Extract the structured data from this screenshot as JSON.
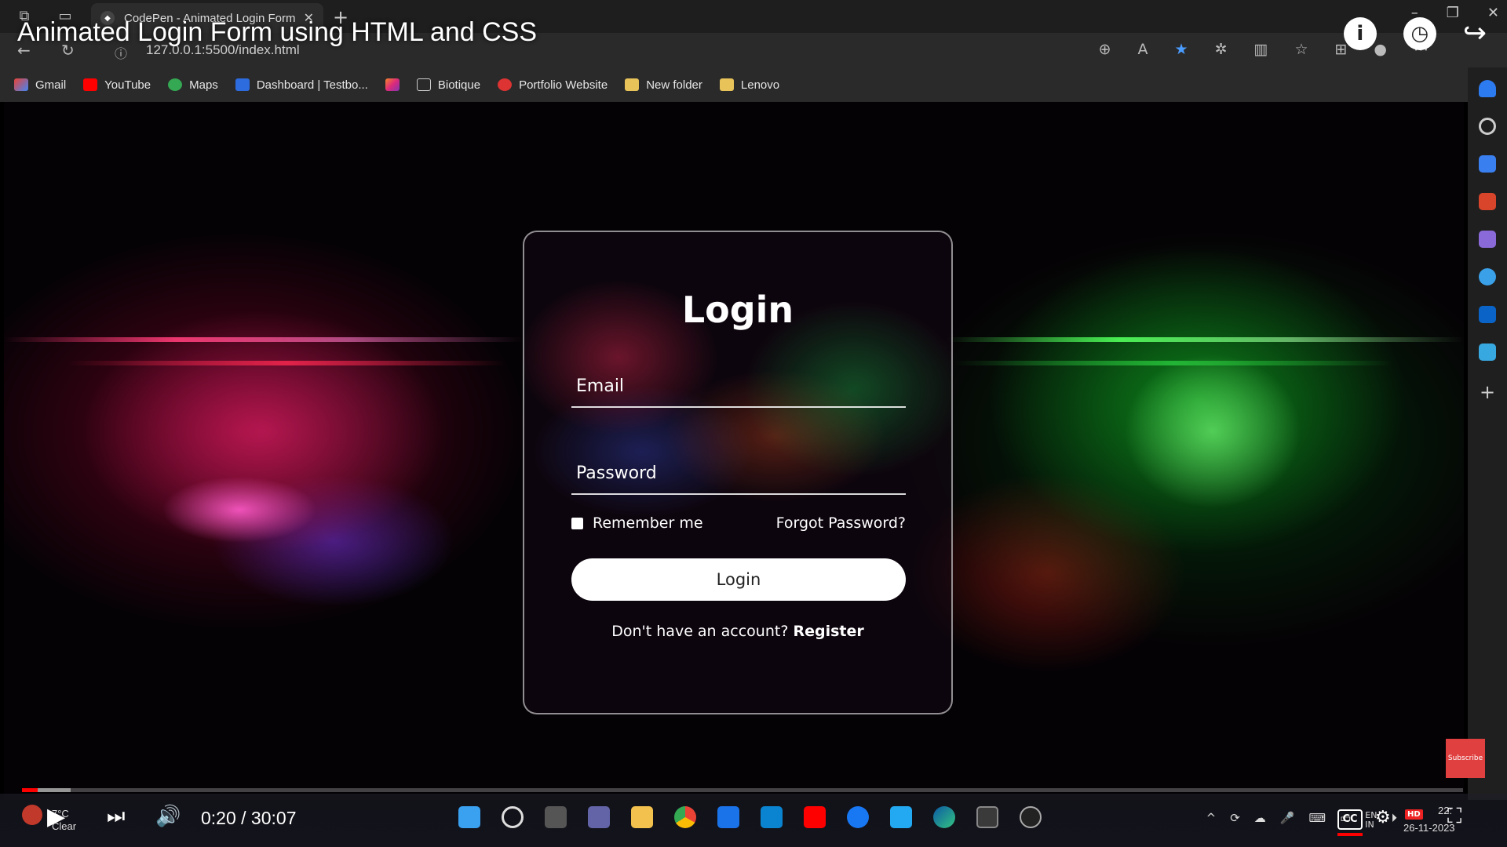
{
  "browser": {
    "tab_title": "CodePen - Animated Login Form",
    "url": "127.0.0.1:5500/index.html",
    "bookmarks": [
      "Gmail",
      "YouTube",
      "Maps",
      "Dashboard | Testbo...",
      "Biotique",
      "Portfolio Website",
      "New folder",
      "Lenovo"
    ]
  },
  "video": {
    "title": "Animated Login Form using HTML and CSS",
    "time": "0:20 / 30:07",
    "progress_fraction": 0.011,
    "buffered_fraction": 0.034,
    "subscribe_label": "Subscribe",
    "cc_label": "CC",
    "hd_label": "HD"
  },
  "login": {
    "title": "Login",
    "email_placeholder": "Email",
    "password_placeholder": "Password",
    "remember_label": "Remember me",
    "forgot_label": "Forgot Password?",
    "button_label": "Login",
    "register_prompt": "Don't have an account?",
    "register_link": "Register"
  },
  "taskbar": {
    "weather_temp": "7°C",
    "weather_desc": "Clear",
    "lang": "EN",
    "region": "IN",
    "time": "22:",
    "date": "26-11-2023"
  },
  "colors": {
    "accent_red": "#ff0000",
    "card_border": "#ffffff"
  }
}
